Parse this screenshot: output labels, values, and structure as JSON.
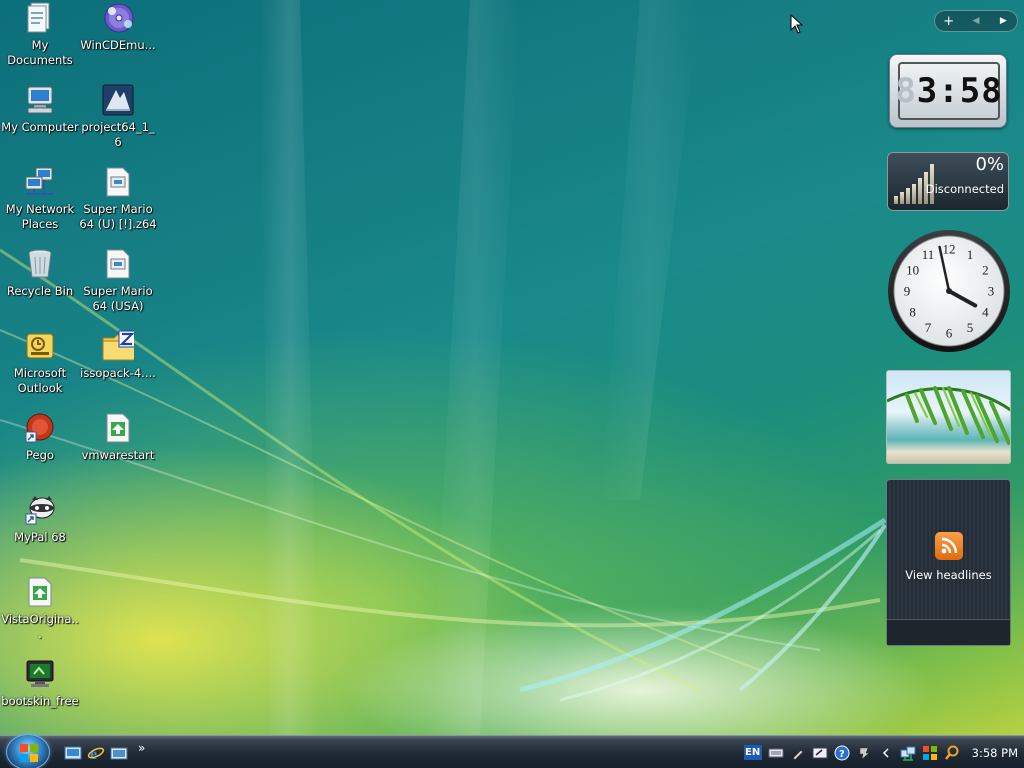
{
  "desktop": {
    "icons": [
      {
        "label": "My Documents",
        "icon": "folder-documents-icon"
      },
      {
        "label": "My Computer",
        "icon": "computer-icon"
      },
      {
        "label": "My Network Places",
        "icon": "network-icon"
      },
      {
        "label": "Recycle Bin",
        "icon": "recycle-bin-icon"
      },
      {
        "label": "Microsoft Outlook",
        "icon": "outlook-icon"
      },
      {
        "label": "Pego",
        "icon": "pego-icon"
      },
      {
        "label": "MyPal 68",
        "icon": "mypal-icon"
      },
      {
        "label": "VistaOrigina...",
        "icon": "file-icon"
      },
      {
        "label": "bootskin_free",
        "icon": "bootskin-icon"
      },
      {
        "label": "WinCDEmu...",
        "icon": "wincdemu-icon"
      },
      {
        "label": "project64_1_6",
        "icon": "project64-icon"
      },
      {
        "label": "Super Mario 64 (U) [!].z64",
        "icon": "rom-file-icon"
      },
      {
        "label": "Super Mario 64 (USA)",
        "icon": "rom-file-icon"
      },
      {
        "label": "issopack-4....",
        "icon": "zip-folder-icon"
      },
      {
        "label": "vmwarestart",
        "icon": "file-icon"
      }
    ]
  },
  "sidebar": {
    "controls": {
      "add": "+",
      "prev": "◀",
      "next": "▶"
    },
    "digital_clock": {
      "ghost_digit": "8",
      "time": "3:58"
    },
    "network_meter": {
      "percent": "0%",
      "status": "Disconnected"
    },
    "analog_clock": {
      "numbers": [
        "12",
        "1",
        "2",
        "3",
        "4",
        "5",
        "6",
        "7",
        "8",
        "9",
        "10",
        "11"
      ],
      "hour": 3,
      "minute": 58
    },
    "feed": {
      "label": "View headlines"
    }
  },
  "taskbar": {
    "tray": {
      "language": "EN",
      "time": "3:58 PM"
    },
    "quicklaunch_more": "»"
  }
}
